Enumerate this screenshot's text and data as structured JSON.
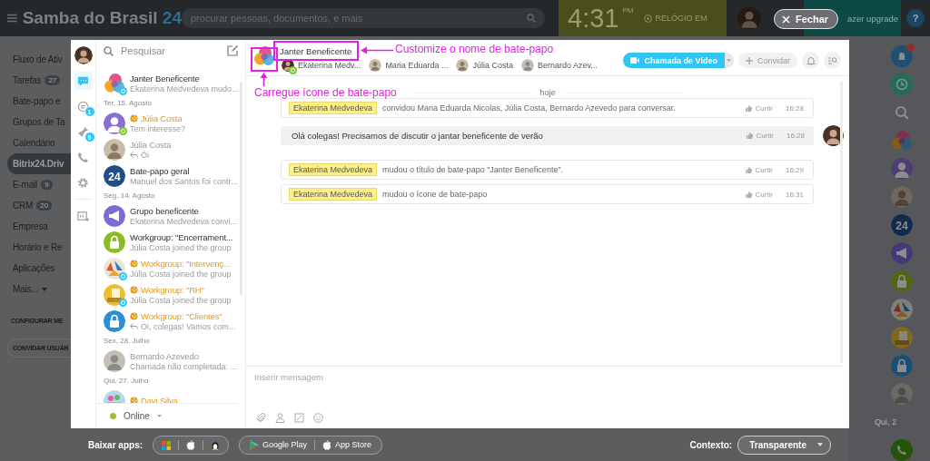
{
  "top_bar": {
    "logo": {
      "name": "Samba do Brasil",
      "suffix": "24"
    },
    "search": {
      "placeholder": "procurar pessoas, documentos, e mais"
    },
    "clock": {
      "time": "4:31",
      "period": "PM",
      "action": "RELÓGIO EM"
    },
    "upgrade": "azer upgrade",
    "help": "?"
  },
  "close_button": "Fechar",
  "left_menu": {
    "items": [
      {
        "label": "Fluxo de Ativ",
        "selected": false
      },
      {
        "label": "Tarefas",
        "count": "27",
        "selected": false
      },
      {
        "label": "Bate-papo e",
        "selected": false
      },
      {
        "label": "Grupos de Ta",
        "selected": false
      },
      {
        "label": "Calendário",
        "selected": false
      },
      {
        "label": "Bitrix24.Driv",
        "selected": true
      },
      {
        "label": "E-mail",
        "count": "9",
        "selected": false
      },
      {
        "label": "CRM",
        "count": "20",
        "selected": false
      },
      {
        "label": "Empresa",
        "selected": false
      },
      {
        "label": "Horário e Re",
        "selected": false
      },
      {
        "label": "Aplicações",
        "selected": false
      },
      {
        "label": "Mais...",
        "selected": false,
        "expandable": true
      }
    ],
    "actions": [
      "CONFIGURAR ME",
      "CONVIDAR USUÁR"
    ]
  },
  "messenger": {
    "rail": [
      {
        "kind": "chats",
        "selected": true
      },
      {
        "kind": "notifications",
        "selected": false,
        "badge": "1"
      },
      {
        "kind": "pin",
        "selected": false,
        "badge": "9"
      },
      {
        "kind": "phone",
        "selected": false
      },
      {
        "kind": "settings",
        "selected": false
      },
      {
        "kind": "board",
        "selected": false
      }
    ],
    "search": {
      "placeholder": "Pesquisar"
    },
    "chats": [
      {
        "kind": "chat",
        "title": "Janter Beneficente",
        "preview": "Ekaterina Medvedeva mudo...",
        "color": "#2fc6f6",
        "external": false,
        "inactive": false,
        "reply": false
      },
      {
        "kind": "date",
        "text": "Ter, 15. Agosto"
      },
      {
        "kind": "chat",
        "title": "Júlia Costa",
        "preview": "Tem interesse?",
        "color": "#7bc62d",
        "external": true,
        "inactive": false,
        "reply": false
      },
      {
        "kind": "chat",
        "title": "Júlia Costa",
        "preview": "Ói",
        "external": false,
        "inactive": true,
        "reply": true
      },
      {
        "kind": "chat",
        "title": "Bate-papo geral",
        "preview": "Manuel dos Santos foi contr...",
        "label": "24",
        "external": false,
        "inactive": false,
        "reply": false
      },
      {
        "kind": "date",
        "text": "Seg, 14. Agosto"
      },
      {
        "kind": "chat",
        "title": "Grupo beneficente",
        "preview": "Ekaterina Medvedeva convi...",
        "external": false,
        "inactive": false,
        "reply": false
      },
      {
        "kind": "chat",
        "title": "Workgroup: \"Encerrament...",
        "preview": "Júlia Costa joined the group",
        "external": false,
        "inactive": false,
        "reply": false
      },
      {
        "kind": "chat",
        "title": "Workgroup: \"Intervenç...",
        "preview": "Júlia Costa joined the group",
        "color": "#2fc6f6",
        "external": true,
        "inactive": false,
        "reply": false
      },
      {
        "kind": "chat",
        "title": "Workgroup: \"RH\"",
        "preview": "Júlia Costa joined the group",
        "color": "#2fc6f6",
        "external": true,
        "inactive": false,
        "reply": false
      },
      {
        "kind": "chat",
        "title": "Workgroup: \"Clientes\"",
        "preview": "Oi, colegas! Vamos com...",
        "external": true,
        "inactive": false,
        "reply": true
      },
      {
        "kind": "date",
        "text": "Sex, 28. Julho"
      },
      {
        "kind": "chat",
        "title": "Bernardo Azevedo",
        "preview": "Chamada não completada: ...",
        "external": false,
        "inactive": true,
        "reply": false
      },
      {
        "kind": "date",
        "text": "Qui, 27. Julho"
      },
      {
        "kind": "chat",
        "title": "Davi Silva",
        "external": true,
        "inactive": false
      }
    ],
    "status": "Online",
    "chat": {
      "title": "Janter Beneficente",
      "members": [
        {
          "name": "Ekaterina Medv...",
          "online": true
        },
        {
          "name": "Maria Eduarda ...",
          "online": false
        },
        {
          "name": "Júlia Costa",
          "online": false
        },
        {
          "name": "Bernardo Azev...",
          "online": false
        }
      ],
      "video_call": "Chamada de Vídeo",
      "invite": "Convidar",
      "day": "hoje",
      "messages": [
        {
          "kind": "system",
          "author": "Ekaterina Medvedeva",
          "text": "convidou Maria Eduarda Nicolas, Júlia Costa, Bernardo Azevedo para conversar.",
          "like": "Curtir",
          "time": "16:28"
        },
        {
          "kind": "own",
          "text": "Olá colegas! Precisamos de discutir o jantar beneficente de verão",
          "like": "Curtir",
          "time": "16:28"
        },
        {
          "kind": "system",
          "author": "Ekaterina Medvedeva",
          "text": "mudou o título de bate-papo \"Janter Beneficente\".",
          "like": "Curtir",
          "time": "16:29"
        },
        {
          "kind": "system",
          "author": "Ekaterina Medvedeva",
          "text": "mudou o ícone de bate-papo",
          "like": "Curtir",
          "time": "16:31"
        }
      ],
      "input": {
        "placeholder": "Inserir mensagem"
      }
    },
    "annotations": [
      "Customize o nome de bate-papo",
      "Carregue ícone de bate-papo"
    ]
  },
  "right_strip": [
    {
      "kind": "alert"
    },
    {
      "kind": "clock"
    },
    {
      "kind": "search"
    },
    {
      "kind": "avatar"
    },
    {
      "kind": "avatar"
    },
    {
      "kind": "avatar"
    },
    {
      "kind": "avatar",
      "label": "24"
    },
    {
      "kind": "avatar"
    },
    {
      "kind": "avatar"
    },
    {
      "kind": "avatar"
    },
    {
      "kind": "avatar"
    },
    {
      "kind": "avatar"
    },
    {
      "kind": "avatar"
    },
    {
      "kind": "date",
      "text": "Qui, 2"
    },
    {
      "kind": "phone"
    }
  ],
  "bottom_bar": {
    "apps_label": "Baixar apps:",
    "stores": [
      "Google Play",
      "App Store"
    ],
    "context_label": "Contexto:",
    "context_value": "Transparente"
  }
}
